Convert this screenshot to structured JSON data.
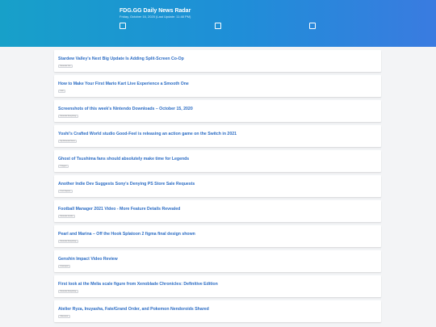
{
  "header": {
    "title": "FDG.GG Daily News Radar",
    "date": "Friday, October 16, 2020 (Last Update: 11:48 PM)",
    "icons": [
      "square-icon",
      "square-icon",
      "square-icon"
    ]
  },
  "articles": [
    {
      "title": "Stardew Valley's Next Big Update Is Adding Split-Screen Co-Op",
      "tag": "Nintendo Life"
    },
    {
      "title": "How to Make Your First Mario Kart Live Experience a Smooth One",
      "tag": "IGN"
    },
    {
      "title": "Screenshots of this week's Nintendo Downloads – October 15, 2020",
      "tag": "Nintendo Everything"
    },
    {
      "title": "Yoshi's Crafted World studio Good-Feel is releasing an action game on the Switch in 2021",
      "tag": "My Nintendo News"
    },
    {
      "title": "Ghost of Tsushima fans should absolutely make time for Legends",
      "tag": "Polygon"
    },
    {
      "title": "Another Indie Dev Suggests Sony's Denying PS Store Sale Requests",
      "tag": "Push Square"
    },
    {
      "title": "Football Manager 2021 Video - More Feature Details Revealed",
      "tag": "Nintendo Insider"
    },
    {
      "title": "Pearl and Marina – Off the Hook Splatoon 2 figma final design shown",
      "tag": "Nintendo Everything"
    },
    {
      "title": "Genshin Impact Video Review",
      "tag": "Gamespot"
    },
    {
      "title": "First look at the Melia scale figure from Xenoblade Chronicles: Definitive Edition",
      "tag": "Nintendo Everything"
    },
    {
      "title": "Atelier Ryza, Inuyasha, Fate/Grand Order, and Pokemon Nendoroids Shared",
      "tag": "Siliconera"
    }
  ]
}
